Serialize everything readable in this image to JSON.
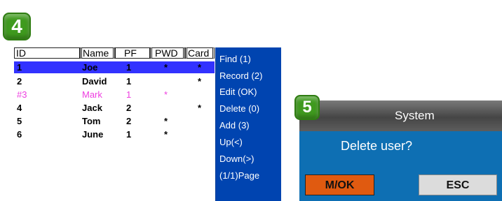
{
  "badges": {
    "step_a": "4",
    "step_b": "5"
  },
  "user_list": {
    "headers": {
      "id": "ID",
      "name": "Name",
      "pf": "PF",
      "pwd": "PWD",
      "card": "Card"
    },
    "rows": [
      {
        "id": "1",
        "name": "Joe",
        "pf": "1",
        "pwd": "*",
        "card": "*"
      },
      {
        "id": "2",
        "name": "David",
        "pf": "1",
        "pwd": "",
        "card": "*"
      },
      {
        "id": "#3",
        "name": "Mark",
        "pf": "1",
        "pwd": "*",
        "card": ""
      },
      {
        "id": "4",
        "name": "Jack",
        "pf": "2",
        "pwd": "",
        "card": "*"
      },
      {
        "id": "5",
        "name": "Tom",
        "pf": "2",
        "pwd": "*",
        "card": ""
      },
      {
        "id": "6",
        "name": "June",
        "pf": "1",
        "pwd": "*",
        "card": ""
      }
    ],
    "menu": [
      "Find (1)",
      "Record (2)",
      "Edit (OK)",
      "Delete (0)",
      "Add (3)",
      "Up(<)",
      "Down(>)",
      "(1/1)Page"
    ]
  },
  "dialog": {
    "title": "System",
    "question": "Delete user?",
    "ok_label": "M/OK",
    "esc_label": "ESC"
  },
  "colors": {
    "menu_bg": "#0044b0",
    "selected_row": "#3232ff",
    "marked_row_text": "#ee3fe0",
    "dialog_bg": "#0e6fb3",
    "ok_button": "#e05a10",
    "badge_green": "#3f9a1e"
  }
}
